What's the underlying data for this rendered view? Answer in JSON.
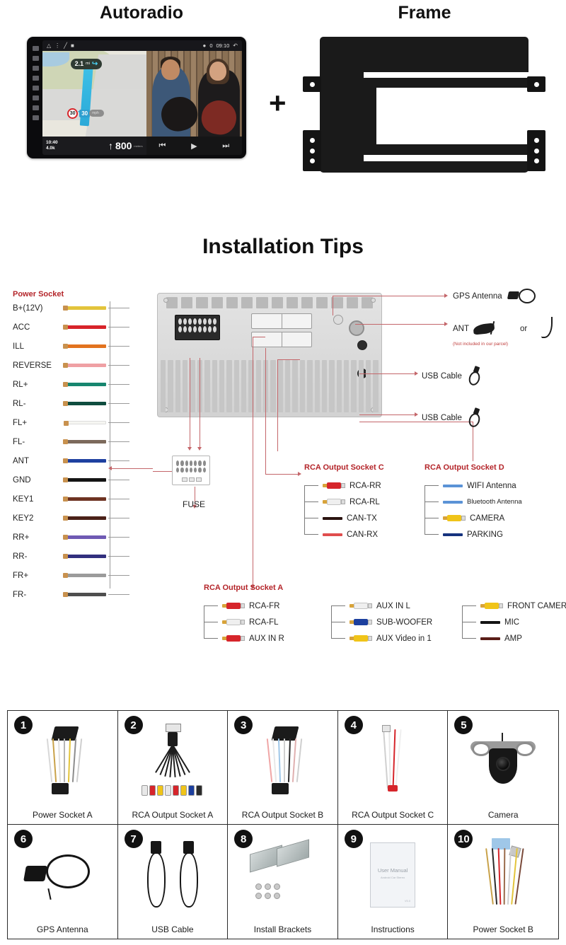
{
  "header": {
    "autoradio_title": "Autoradio",
    "frame_title": "Frame",
    "plus": "+"
  },
  "radio_screen": {
    "status_time": "09:10",
    "status_gps_count": "0",
    "nav_distance": "2.1",
    "nav_distance_unit": "mi",
    "turn_icon": "turn-right-icon",
    "speed_limit": "30",
    "current_speed": "30",
    "speed_unit": "mph",
    "eta_time": "10:40",
    "eta_distance": "4.0k",
    "remaining_distance": "800",
    "remaining_unit": "meters",
    "media_prev": "prev-track-icon",
    "media_play": "play-icon",
    "media_next": "next-track-icon",
    "home_icon": "home-icon",
    "back_icon": "back-icon"
  },
  "tips": {
    "title": "Installation Tips"
  },
  "power_socket": {
    "title": "Power Socket",
    "wires": [
      {
        "label": "B+(12V)",
        "color": "#e3c43b"
      },
      {
        "label": "ACC",
        "color": "#d8232a"
      },
      {
        "label": "ILL",
        "color": "#e2731f"
      },
      {
        "label": "REVERSE",
        "color": "#efa0a4"
      },
      {
        "label": "RL+",
        "color": "#17866f"
      },
      {
        "label": "RL-",
        "color": "#0f4d3f"
      },
      {
        "label": "FL+",
        "color": "#f6f6f2"
      },
      {
        "label": "FL-",
        "color": "#7c6a5c"
      },
      {
        "label": "ANT",
        "color": "#1e40a0"
      },
      {
        "label": "GND",
        "color": "#141414"
      },
      {
        "label": "KEY1",
        "color": "#6e3322"
      },
      {
        "label": "KEY2",
        "color": "#4a2118"
      },
      {
        "label": "RR+",
        "color": "#6f5ab4"
      },
      {
        "label": "RR-",
        "color": "#32307e"
      },
      {
        "label": "FR+",
        "color": "#9b9b9b"
      },
      {
        "label": "FR-",
        "color": "#4e4e4e"
      }
    ]
  },
  "fuse": {
    "label": "FUSE"
  },
  "peripherals": [
    {
      "label": "GPS Antenna",
      "icon": "gps-antenna-icon",
      "note": ""
    },
    {
      "label": "ANT",
      "icon": "antenna-icon",
      "note": "(Not included in our parcel)",
      "alt_text": "or",
      "alt_icon": "antenna-alt-icon"
    },
    {
      "label": "USB  Cable",
      "icon": "usb-cable-icon",
      "note": ""
    },
    {
      "label": "USB Cable",
      "icon": "usb-cable-icon",
      "note": ""
    }
  ],
  "socket_c": {
    "title": "RCA Output Socket C",
    "rows": [
      {
        "label": "RCA-RR",
        "type": "rca",
        "color": "#d6252b"
      },
      {
        "label": "RCA-RL",
        "type": "rca",
        "color": "#efefef"
      },
      {
        "label": "CAN-TX",
        "type": "wire",
        "color": "#2b1410"
      },
      {
        "label": "CAN-RX",
        "type": "wire",
        "color": "#e04d4d"
      }
    ]
  },
  "socket_d": {
    "title": "RCA Output Socket D",
    "rows": [
      {
        "label": "WIFI Antenna",
        "type": "wire",
        "color": "#5b93d6",
        "small": false
      },
      {
        "label": "Bluetooth Antenna",
        "type": "wire",
        "color": "#5b93d6",
        "small": true
      },
      {
        "label": "CAMERA",
        "type": "rca",
        "color": "#f0c419",
        "small": false
      },
      {
        "label": "PARKING",
        "type": "wire",
        "color": "#16337e",
        "small": false
      }
    ]
  },
  "socket_a": {
    "title": "RCA Output Socket A",
    "columns": [
      [
        {
          "label": "RCA-FR",
          "type": "rca",
          "color": "#d6252b"
        },
        {
          "label": "RCA-FL",
          "type": "rca",
          "color": "#efefef"
        },
        {
          "label": "AUX IN R",
          "type": "rca",
          "color": "#d6252b"
        }
      ],
      [
        {
          "label": "AUX IN L",
          "type": "rca",
          "color": "#efefef"
        },
        {
          "label": "SUB-WOOFER",
          "type": "rca",
          "color": "#1c3f9e"
        },
        {
          "label": "AUX Video in 1",
          "type": "rca",
          "color": "#f0c419"
        }
      ],
      [
        {
          "label": "FRONT CAMERA",
          "type": "rca",
          "color": "#f0c419"
        },
        {
          "label": "MIC",
          "type": "wire",
          "color": "#141414"
        },
        {
          "label": "AMP",
          "type": "wire",
          "color": "#5a1d18"
        }
      ]
    ]
  },
  "accessories": [
    {
      "num": "1",
      "caption": "Power Socket A",
      "art": "power-harness-a"
    },
    {
      "num": "2",
      "caption": "RCA Output Socket A",
      "art": "rca-fanout"
    },
    {
      "num": "3",
      "caption": "RCA Output Socket B",
      "art": "rca-socket-b"
    },
    {
      "num": "4",
      "caption": "RCA Output Socket C",
      "art": "rca-socket-c"
    },
    {
      "num": "5",
      "caption": "Camera",
      "art": "camera"
    },
    {
      "num": "6",
      "caption": "GPS Antenna",
      "art": "gps-antenna"
    },
    {
      "num": "7",
      "caption": "USB Cable",
      "art": "usb-cable"
    },
    {
      "num": "8",
      "caption": "Install Brackets",
      "art": "brackets"
    },
    {
      "num": "9",
      "caption": "Instructions",
      "art": "manual"
    },
    {
      "num": "10",
      "caption": "Power Socket B",
      "art": "power-harness-b"
    }
  ],
  "manual_cover": {
    "title": "User Manual",
    "subtitle": "Android Car Stereo",
    "version": "V5.0"
  }
}
